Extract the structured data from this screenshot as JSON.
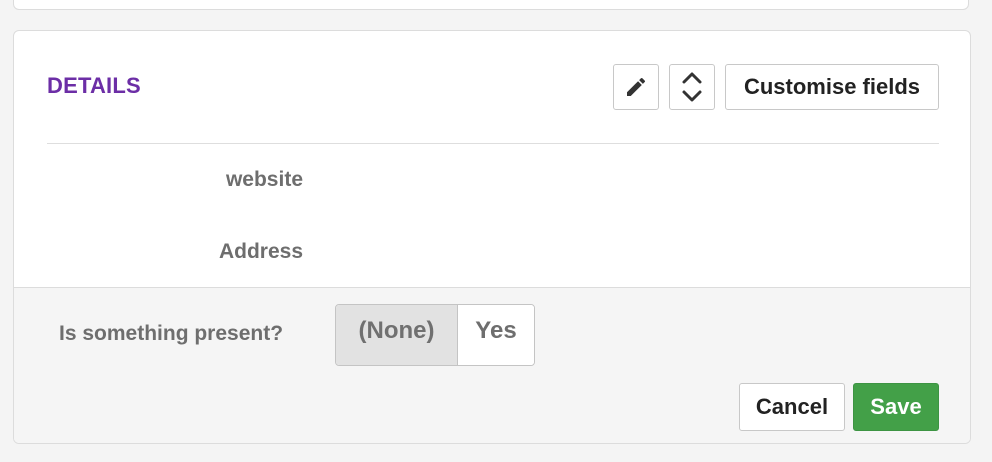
{
  "details": {
    "title": "DETAILS",
    "edit_icon": "pencil-icon",
    "sort_icon": "chevron-up-down-icon",
    "customise_label": "Customise fields",
    "fields": [
      {
        "label": "website"
      },
      {
        "label": "Address"
      }
    ]
  },
  "edit_panel": {
    "question": "Is something present?",
    "options": [
      "(None)",
      "Yes"
    ],
    "selected": "(None)",
    "cancel_label": "Cancel",
    "save_label": "Save"
  },
  "colors": {
    "title": "#6c2ea6",
    "save_button": "#43a048",
    "selected_option": "#e2e2e2"
  }
}
